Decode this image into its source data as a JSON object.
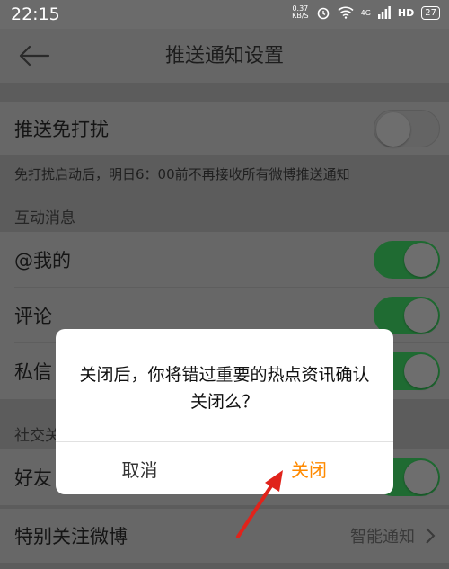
{
  "status_bar": {
    "time": "22:15",
    "speed_value": "0.37",
    "speed_unit": "KB/S",
    "network": "4G",
    "hd": "HD",
    "battery": "27"
  },
  "app_bar": {
    "title": "推送通知设置"
  },
  "dnd": {
    "label": "推送免打扰",
    "enabled": false,
    "hint": "免打扰启动后，明日6：00前不再接收所有微博推送通知"
  },
  "interaction": {
    "section_label": "互动消息",
    "items": [
      {
        "label": "@我的",
        "enabled": true
      },
      {
        "label": "评论",
        "enabled": true
      },
      {
        "label": "私信",
        "enabled": true
      }
    ]
  },
  "social": {
    "section_label": "社交关",
    "items": [
      {
        "label": "好友",
        "enabled": true
      }
    ]
  },
  "special_follow": {
    "label": "特别关注微博",
    "value": "智能通知"
  },
  "dialog": {
    "message": "关闭后，你将错过重要的热点资讯确认关闭么？",
    "cancel_label": "取消",
    "confirm_label": "关闭"
  },
  "colors": {
    "accent": "#ff8a00",
    "toggle_on": "#1f6b32",
    "arrow": "#e0231b"
  }
}
